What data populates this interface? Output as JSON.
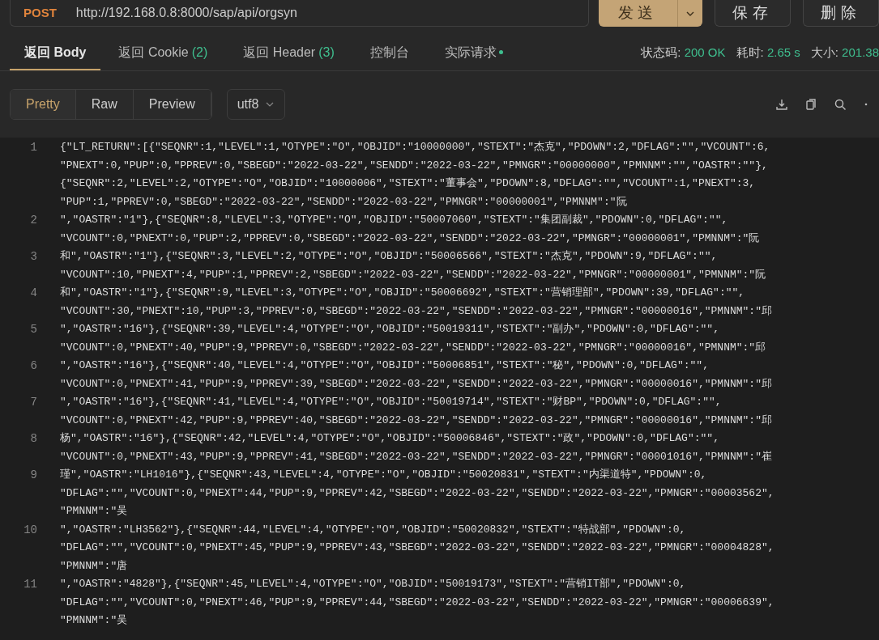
{
  "request": {
    "method": "POST",
    "url": "http://192.168.0.8:8000/sap/api/orgsyn"
  },
  "actions": [
    {
      "label": "发送",
      "kind": "primary"
    },
    {
      "label": "保存",
      "kind": "plain"
    },
    {
      "label": "删除",
      "kind": "plain"
    }
  ],
  "response_tabs": [
    {
      "label": "返回 Body",
      "selected": true,
      "dot": false
    },
    {
      "label": "返回 Cookie",
      "count": "(2)",
      "selected": false,
      "dot": false
    },
    {
      "label": "返回 Header",
      "count": "(3)",
      "selected": false,
      "dot": false
    },
    {
      "label": "控制台",
      "selected": false,
      "dot": false
    },
    {
      "label": "实际请求",
      "selected": false,
      "dot": true
    }
  ],
  "status": [
    {
      "label": "状态码:",
      "value": "200 OK"
    },
    {
      "label": "耗时:",
      "value": "2.65 s"
    },
    {
      "label": "大小:",
      "value": "201.38"
    }
  ],
  "view_modes": [
    {
      "label": "Pretty",
      "selected": true
    },
    {
      "label": "Raw",
      "selected": false
    },
    {
      "label": "Preview",
      "selected": false
    }
  ],
  "encoding": "utf8",
  "code_lines": [
    {
      "number": "1",
      "rows": [
        "{\"LT_RETURN\":[{\"SEQNR\":1,\"LEVEL\":1,\"OTYPE\":\"O\",\"OBJID\":\"10000000\",\"STEXT\":\"杰克\",\"PDOWN\":2,\"DFLAG\":\"\",\"VCOUNT\":6,",
        "\"PNEXT\":0,\"PUP\":0,\"PPREV\":0,\"SBEGD\":\"2022-03-22\",\"SENDD\":\"2022-03-22\",\"PMNGR\":\"00000000\",\"PMNNM\":\"\",\"OASTR\":\"\"},",
        "{\"SEQNR\":2,\"LEVEL\":2,\"OTYPE\":\"O\",\"OBJID\":\"10000006\",\"STEXT\":\"董事会\",\"PDOWN\":8,\"DFLAG\":\"\",\"VCOUNT\":1,\"PNEXT\":3,",
        "\"PUP\":1,\"PPREV\":0,\"SBEGD\":\"2022-03-22\",\"SENDD\":\"2022-03-22\",\"PMNGR\":\"00000001\",\"PMNNM\":\"阮"
      ]
    },
    {
      "number": "2",
      "rows": [
        "\",\"OASTR\":\"1\"},{\"SEQNR\":8,\"LEVEL\":3,\"OTYPE\":\"O\",\"OBJID\":\"50007060\",\"STEXT\":\"集团副裁\",\"PDOWN\":0,\"DFLAG\":\"\",",
        "\"VCOUNT\":0,\"PNEXT\":0,\"PUP\":2,\"PPREV\":0,\"SBEGD\":\"2022-03-22\",\"SENDD\":\"2022-03-22\",\"PMNGR\":\"00000001\",\"PMNNM\":\"阮"
      ]
    },
    {
      "number": "3",
      "rows": [
        "和\",\"OASTR\":\"1\"},{\"SEQNR\":3,\"LEVEL\":2,\"OTYPE\":\"O\",\"OBJID\":\"50006566\",\"STEXT\":\"杰克\",\"PDOWN\":9,\"DFLAG\":\"\",",
        "\"VCOUNT\":10,\"PNEXT\":4,\"PUP\":1,\"PPREV\":2,\"SBEGD\":\"2022-03-22\",\"SENDD\":\"2022-03-22\",\"PMNGR\":\"00000001\",\"PMNNM\":\"阮"
      ]
    },
    {
      "number": "4",
      "rows": [
        "和\",\"OASTR\":\"1\"},{\"SEQNR\":9,\"LEVEL\":3,\"OTYPE\":\"O\",\"OBJID\":\"50006692\",\"STEXT\":\"营销理部\",\"PDOWN\":39,\"DFLAG\":\"\",",
        "\"VCOUNT\":30,\"PNEXT\":10,\"PUP\":3,\"PPREV\":0,\"SBEGD\":\"2022-03-22\",\"SENDD\":\"2022-03-22\",\"PMNGR\":\"00000016\",\"PMNNM\":\"邱"
      ]
    },
    {
      "number": "5",
      "rows": [
        "\",\"OASTR\":\"16\"},{\"SEQNR\":39,\"LEVEL\":4,\"OTYPE\":\"O\",\"OBJID\":\"50019311\",\"STEXT\":\"副办\",\"PDOWN\":0,\"DFLAG\":\"\",",
        "\"VCOUNT\":0,\"PNEXT\":40,\"PUP\":9,\"PPREV\":0,\"SBEGD\":\"2022-03-22\",\"SENDD\":\"2022-03-22\",\"PMNGR\":\"00000016\",\"PMNNM\":\"邱"
      ]
    },
    {
      "number": "6",
      "rows": [
        "\",\"OASTR\":\"16\"},{\"SEQNR\":40,\"LEVEL\":4,\"OTYPE\":\"O\",\"OBJID\":\"50006851\",\"STEXT\":\"秘\",\"PDOWN\":0,\"DFLAG\":\"\",",
        "\"VCOUNT\":0,\"PNEXT\":41,\"PUP\":9,\"PPREV\":39,\"SBEGD\":\"2022-03-22\",\"SENDD\":\"2022-03-22\",\"PMNGR\":\"00000016\",\"PMNNM\":\"邱"
      ]
    },
    {
      "number": "7",
      "rows": [
        "\",\"OASTR\":\"16\"},{\"SEQNR\":41,\"LEVEL\":4,\"OTYPE\":\"O\",\"OBJID\":\"50019714\",\"STEXT\":\"财BP\",\"PDOWN\":0,\"DFLAG\":\"\",",
        "\"VCOUNT\":0,\"PNEXT\":42,\"PUP\":9,\"PPREV\":40,\"SBEGD\":\"2022-03-22\",\"SENDD\":\"2022-03-22\",\"PMNGR\":\"00000016\",\"PMNNM\":\"邱"
      ]
    },
    {
      "number": "8",
      "rows": [
        "杨\",\"OASTR\":\"16\"},{\"SEQNR\":42,\"LEVEL\":4,\"OTYPE\":\"O\",\"OBJID\":\"50006846\",\"STEXT\":\"政\",\"PDOWN\":0,\"DFLAG\":\"\",",
        "\"VCOUNT\":0,\"PNEXT\":43,\"PUP\":9,\"PPREV\":41,\"SBEGD\":\"2022-03-22\",\"SENDD\":\"2022-03-22\",\"PMNGR\":\"00001016\",\"PMNNM\":\"崔"
      ]
    },
    {
      "number": "9",
      "rows": [
        "瑾\",\"OASTR\":\"LH1016\"},{\"SEQNR\":43,\"LEVEL\":4,\"OTYPE\":\"O\",\"OBJID\":\"50020831\",\"STEXT\":\"内渠道特\",\"PDOWN\":0,",
        "\"DFLAG\":\"\",\"VCOUNT\":0,\"PNEXT\":44,\"PUP\":9,\"PPREV\":42,\"SBEGD\":\"2022-03-22\",\"SENDD\":\"2022-03-22\",\"PMNGR\":\"00003562\",",
        "\"PMNNM\":\"吴"
      ]
    },
    {
      "number": "10",
      "rows": [
        "\",\"OASTR\":\"LH3562\"},{\"SEQNR\":44,\"LEVEL\":4,\"OTYPE\":\"O\",\"OBJID\":\"50020832\",\"STEXT\":\"特战部\",\"PDOWN\":0,",
        "\"DFLAG\":\"\",\"VCOUNT\":0,\"PNEXT\":45,\"PUP\":9,\"PPREV\":43,\"SBEGD\":\"2022-03-22\",\"SENDD\":\"2022-03-22\",\"PMNGR\":\"00004828\",",
        "\"PMNNM\":\"唐"
      ]
    },
    {
      "number": "11",
      "rows": [
        "\",\"OASTR\":\"4828\"},{\"SEQNR\":45,\"LEVEL\":4,\"OTYPE\":\"O\",\"OBJID\":\"50019173\",\"STEXT\":\"营销IT部\",\"PDOWN\":0,",
        "\"DFLAG\":\"\",\"VCOUNT\":0,\"PNEXT\":46,\"PUP\":9,\"PPREV\":44,\"SBEGD\":\"2022-03-22\",\"SENDD\":\"2022-03-22\",\"PMNGR\":\"00006639\",",
        "\"PMNNM\":\"吴"
      ]
    }
  ]
}
